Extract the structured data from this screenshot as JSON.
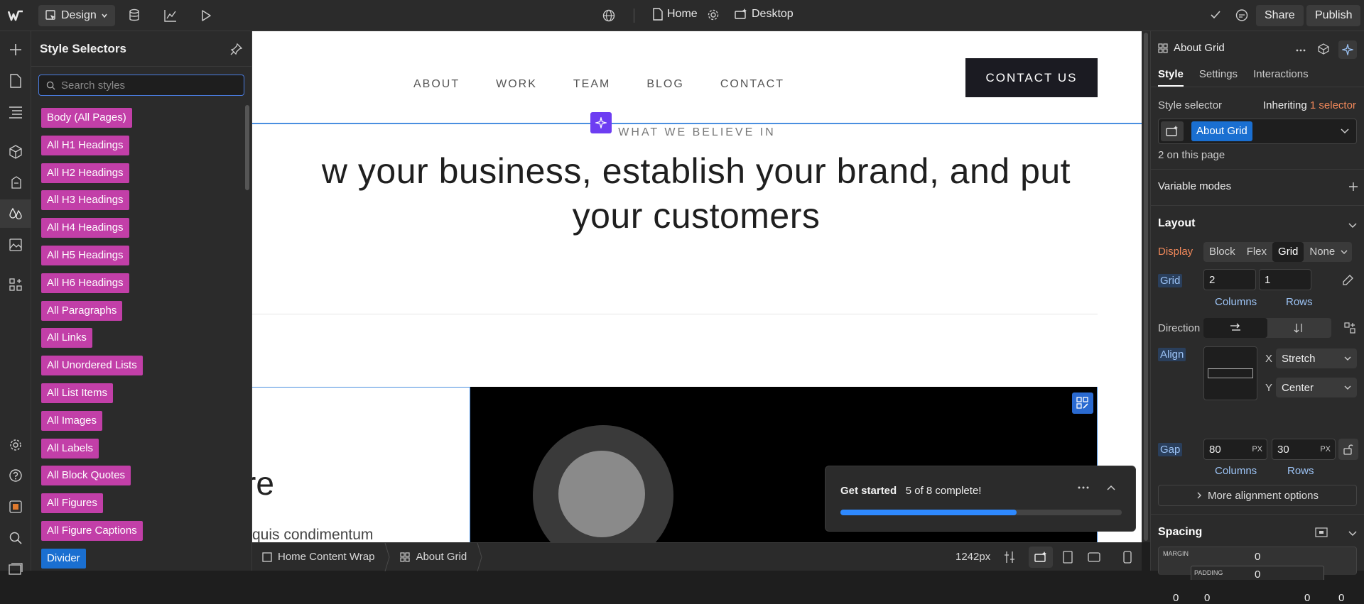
{
  "topbar": {
    "mode_label": "Design",
    "page_label": "Home",
    "breakpoint_label": "Desktop",
    "share_label": "Share",
    "publish_label": "Publish"
  },
  "panel": {
    "title": "Style Selectors",
    "search_placeholder": "Search styles",
    "selectors": [
      {
        "label": "Body (All Pages)"
      },
      {
        "label": "All H1 Headings"
      },
      {
        "label": "All H2 Headings"
      },
      {
        "label": "All H3 Headings"
      },
      {
        "label": "All H4 Headings"
      },
      {
        "label": "All H5 Headings"
      },
      {
        "label": "All H6 Headings"
      },
      {
        "label": "All Paragraphs"
      },
      {
        "label": "All Links"
      },
      {
        "label": "All Unordered Lists"
      },
      {
        "label": "All List Items"
      },
      {
        "label": "All Images"
      },
      {
        "label": "All Labels"
      },
      {
        "label": "All Block Quotes"
      },
      {
        "label": "All Figures"
      },
      {
        "label": "All Figure Captions"
      },
      {
        "label": "Divider"
      }
    ]
  },
  "canvas": {
    "nav": [
      "ABOUT",
      "WORK",
      "TEAM",
      "BLOG",
      "CONTACT"
    ],
    "cta": "CONTACT US",
    "eyebrow": "WHAT WE BELIEVE IN",
    "heading_line1": "w your business, establish your brand, and put",
    "heading_line2": "your customers",
    "partial_heading": "re",
    "partial_text": "quis condimentum"
  },
  "toast": {
    "title": "Get started",
    "progress_text": "5 of 8 complete!",
    "progress": 0.625
  },
  "bottombar": {
    "crumb1": "Home Content Wrap",
    "crumb2": "About Grid",
    "width_label": "1242px"
  },
  "right": {
    "element_name": "About Grid",
    "tabs": [
      "Style",
      "Settings",
      "Interactions"
    ],
    "style_selector_label": "Style selector",
    "inheriting_label": "Inheriting",
    "inheriting_count": "1 selector",
    "selector_chip": "About Grid",
    "on_page": "2 on this page",
    "variable_modes": "Variable modes",
    "layout_title": "Layout",
    "display_label": "Display",
    "display_options": [
      "Block",
      "Flex",
      "Grid",
      "None"
    ],
    "grid_label": "Grid",
    "grid_columns": "2",
    "grid_rows": "1",
    "columns_label": "Columns",
    "rows_label": "Rows",
    "direction_label": "Direction",
    "align_label": "Align",
    "align_x_label": "X",
    "align_x_value": "Stretch",
    "align_y_label": "Y",
    "align_y_value": "Center",
    "gap_label": "Gap",
    "gap_columns": "80",
    "gap_rows": "30",
    "gap_unit": "PX",
    "more_alignment": "More alignment options",
    "spacing_title": "Spacing",
    "margin_label": "MARGIN",
    "margin_value": "0",
    "padding_label": "PADDING",
    "padding_value": "0",
    "margin_left": "0",
    "padding_left": "0",
    "padding_right": "0",
    "margin_right": "0"
  },
  "colors": {
    "selector_pink": "#c23fa8",
    "selector_blue": "#1a6fd1",
    "accent_purple": "#6d3df2",
    "selection_blue": "#4a8fe0"
  }
}
